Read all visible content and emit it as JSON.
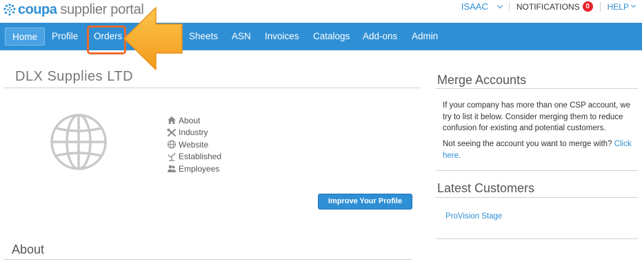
{
  "header": {
    "logo_brand": "coupa",
    "logo_sub": "supplier portal",
    "user_name": "ISAAC",
    "notifications_label": "NOTIFICATIONS",
    "notifications_count": "0",
    "help_label": "HELP"
  },
  "nav": {
    "items": [
      {
        "label": "Home"
      },
      {
        "label": "Profile"
      },
      {
        "label": "Orders"
      },
      {
        "label": "Sheets"
      },
      {
        "label": "ASN"
      },
      {
        "label": "Invoices"
      },
      {
        "label": "Catalogs"
      },
      {
        "label": "Add-ons"
      },
      {
        "label": "Admin"
      }
    ],
    "active": "Home",
    "highlighted": "Orders"
  },
  "profile": {
    "company_name": "DLX Supplies LTD",
    "fields": [
      {
        "label": "About",
        "icon": "house-icon"
      },
      {
        "label": "Industry",
        "icon": "tools-icon"
      },
      {
        "label": "Website",
        "icon": "globe-small-icon"
      },
      {
        "label": "Established",
        "icon": "sprout-icon"
      },
      {
        "label": "Employees",
        "icon": "people-icon"
      }
    ],
    "improve_button": "Improve Your Profile",
    "about_heading": "About"
  },
  "merge_accounts": {
    "heading": "Merge Accounts",
    "text": "If your company has more than one CSP account, we try to list it below. Consider merging them to reduce confusion for existing and potential customers.",
    "question": "Not seeing the account you want to merge with?",
    "link": "Click here."
  },
  "latest_customers": {
    "heading": "Latest Customers",
    "customers": [
      "ProVision Stage"
    ]
  },
  "colors": {
    "brand_blue": "#2f8fd5",
    "highlight_orange": "#ec6a2a",
    "arrow_orange": "#f7a726",
    "badge_red": "#e8202a"
  }
}
